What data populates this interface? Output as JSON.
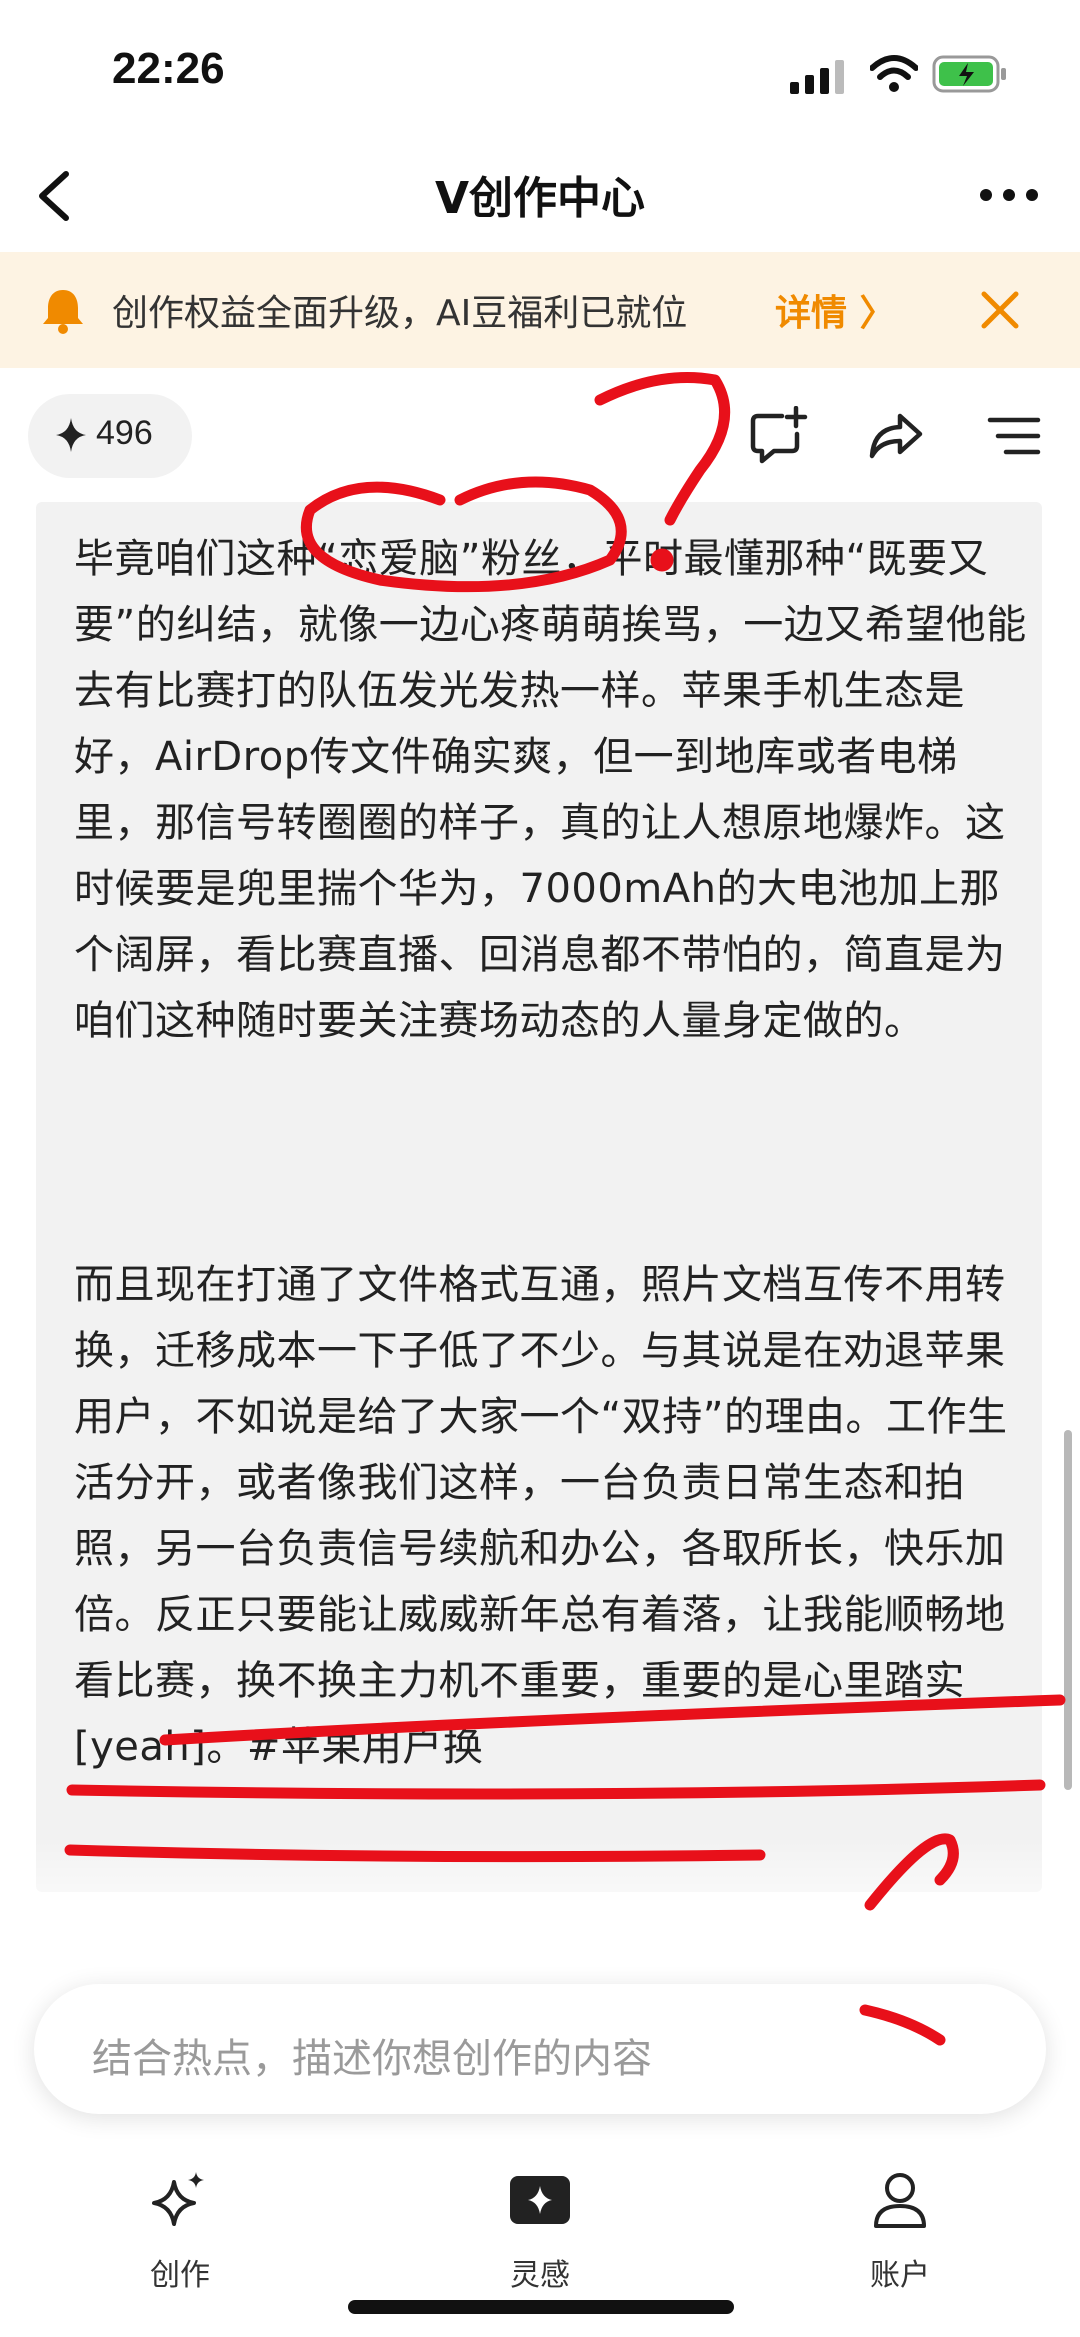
{
  "status_bar": {
    "time": "22:26"
  },
  "nav": {
    "title": "V创作中心"
  },
  "notice": {
    "text": "创作权益全面升级，AI豆福利已就位",
    "detail": "详情 〉"
  },
  "toolbar": {
    "credit_count": "496"
  },
  "content": {
    "paragraph1": "毕竟咱们这种“恋爱脑”粉丝，平时最懂那种“既要又要”的纠结，就像一边心疼萌萌挨骂，一边又希望他能去有比赛打的队伍发光发热一样。苹果手机生态是好，AirDrop传文件确实爽，但一到地库或者电梯里，那信号转圈圈的样子，真的让人想原地爆炸。这时候要是兜里揣个华为，7000mAh的大电池加上那个阔屏，看比赛直播、回消息都不带怕的，简直是为咱们这种随时要关注赛场动态的人量身定做的。",
    "paragraph2": "而且现在打通了文件格式互通，照片文档互传不用转换，迁移成本一下子低了不少。与其说是在劝退苹果用户，不如说是给了大家一个“双持”的理由。工作生活分开，或者像我们这样，一台负责日常生态和拍照，另一台负责信号续航和办公，各取所长，快乐加倍。反正只要能让威威新年总有着落，让我能顺畅地看比赛，换不换主力机不重要，重要的是心里踏实[yeah]。#苹果用户换"
  },
  "input": {
    "placeholder": "结合热点，描述你想创作的内容"
  },
  "tabs": [
    {
      "label": "创作"
    },
    {
      "label": "灵感"
    },
    {
      "label": "账户"
    }
  ],
  "colors": {
    "accent": "#f08a00",
    "notice_bg": "#fdf3e3",
    "annotation": "#e8101a"
  }
}
